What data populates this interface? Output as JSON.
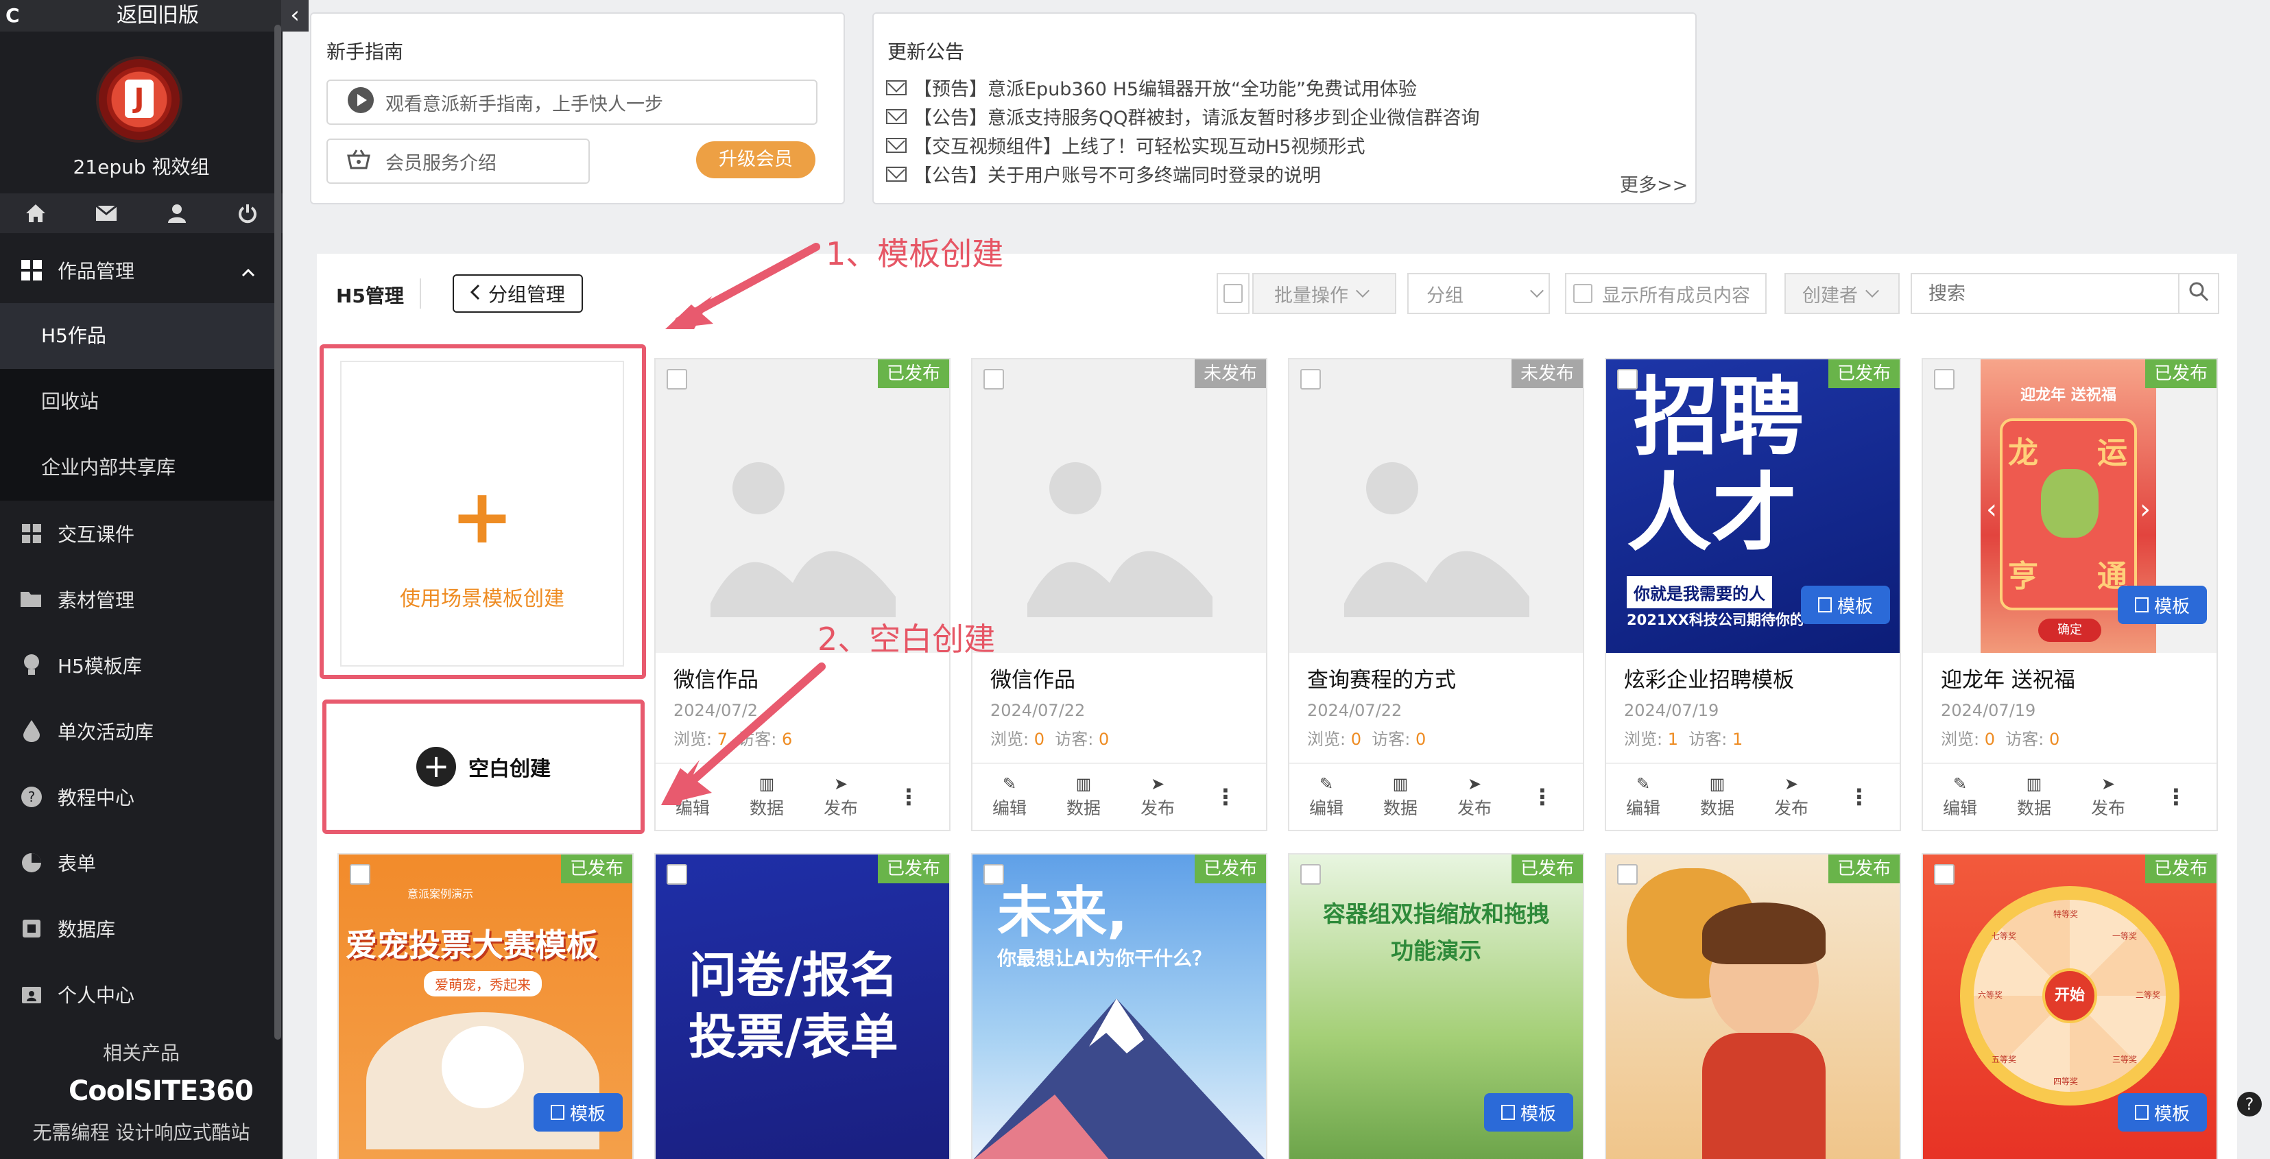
{
  "sidebar": {
    "logo_glyph": "C",
    "back_label": "返回旧版",
    "collapse_glyph": "‹",
    "user_name": "21epub 视效组",
    "quick_icons": [
      "home-icon",
      "mail-icon",
      "user-icon",
      "power-icon"
    ],
    "section_works": "作品管理",
    "sub_items": [
      "H5作品",
      "回收站",
      "企业内部共享库"
    ],
    "items": [
      {
        "label": "交互课件",
        "icon": "grid-icon"
      },
      {
        "label": "素材管理",
        "icon": "folder-icon"
      },
      {
        "label": "H5模板库",
        "icon": "bulb-icon"
      },
      {
        "label": "单次活动库",
        "icon": "drop-icon"
      },
      {
        "label": "教程中心",
        "icon": "help-icon"
      },
      {
        "label": "表单",
        "icon": "pie-icon"
      },
      {
        "label": "数据库",
        "icon": "box-icon"
      },
      {
        "label": "个人中心",
        "icon": "id-icon"
      }
    ],
    "related": "相关产品",
    "coolsite": "CoolSITE360",
    "slogan": "无需编程 设计响应式酷站"
  },
  "guide": {
    "title": "新手指南",
    "watch": "观看意派新手指南，上手快人一步",
    "member": "会员服务介绍",
    "upgrade": "升级会员"
  },
  "notices": {
    "title": "更新公告",
    "items": [
      "【预告】意派Epub360 H5编辑器开放“全功能”免费试用体验",
      "【公告】意派支持服务QQ群被封，请派友暂时移步到企业微信群咨询",
      "【交互视频组件】上线了！可轻松实现互动H5视频形式",
      "【公告】关于用户账号不可多终端同时登录的说明"
    ],
    "more": "更多>>"
  },
  "toolbar": {
    "title": "H5管理",
    "group": "分组管理",
    "batch": "批量操作",
    "group_filter": "分组",
    "show_all": "显示所有成员内容",
    "creator": "创建者",
    "search_placeholder": "搜索"
  },
  "create": {
    "template_label": "使用场景模板创建",
    "blank_label": "空白创建"
  },
  "annotations": {
    "a1": "1、模板创建",
    "a2": "2、空白创建"
  },
  "card_labels": {
    "edit": "编辑",
    "data": "数据",
    "publish": "发布",
    "views": "浏览:",
    "visits": "访客:",
    "template": "模板"
  },
  "cards": [
    {
      "status": "已发布",
      "title": "微信作品",
      "date": "2024/07/2",
      "views": "7",
      "visits": "6"
    },
    {
      "status": "未发布",
      "title": "微信作品",
      "date": "2024/07/22",
      "views": "0",
      "visits": "0"
    },
    {
      "status": "未发布",
      "title": "查询赛程的方式",
      "date": "2024/07/22",
      "views": "0",
      "visits": "0"
    },
    {
      "status": "已发布",
      "title": "炫彩企业招聘模板",
      "date": "2024/07/19",
      "views": "1",
      "visits": "1",
      "poster": [
        "招聘",
        "人才",
        "你就是我需要的人",
        "2021XX科技公司期待你的"
      ]
    },
    {
      "status": "已发布",
      "title": "迎龙年 送祝福",
      "date": "2024/07/19",
      "views": "0",
      "visits": "0",
      "poster": [
        "迎龙年 送祝福",
        "龙",
        "运",
        "亨",
        "通",
        "确定"
      ]
    }
  ],
  "row2": [
    {
      "status": "已发布",
      "text": [
        "意派案例演示",
        "爱宠投票大赛模板",
        "爱萌宠，秀起来"
      ],
      "template": true
    },
    {
      "status": "已发布",
      "text": [
        "问卷/报名",
        "投票/表单"
      ],
      "template": false
    },
    {
      "status": "已发布",
      "text": [
        "未来,",
        "你最想让AI为你干什么？"
      ],
      "template": false
    },
    {
      "status": "已发布",
      "text": [
        "容器组双指缩放和拖拽",
        "功能演示"
      ],
      "template": true
    },
    {
      "status": "已发布",
      "text": [],
      "template": false
    },
    {
      "status": "已发布",
      "text": [
        "开始",
        "特等奖",
        "一等奖",
        "二等奖",
        "三等奖",
        "四等奖",
        "五等奖",
        "六等奖",
        "七等奖"
      ],
      "template": true
    }
  ],
  "help_glyph": "?"
}
